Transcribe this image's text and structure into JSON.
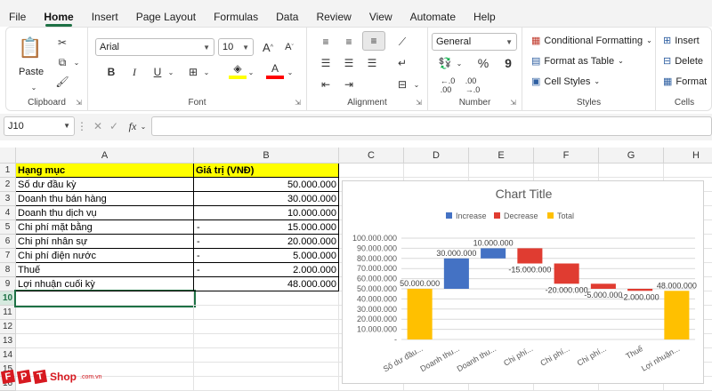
{
  "menu": {
    "tabs": [
      "File",
      "Home",
      "Insert",
      "Page Layout",
      "Formulas",
      "Data",
      "Review",
      "View",
      "Automate",
      "Help"
    ],
    "active": "Home"
  },
  "ribbon": {
    "clipboard": {
      "label": "Clipboard",
      "paste": "Paste"
    },
    "font": {
      "label": "Font",
      "name": "Arial",
      "size": "10",
      "bold": "B",
      "italic": "I",
      "underline": "U"
    },
    "alignment": {
      "label": "Alignment"
    },
    "number": {
      "label": "Number",
      "format": "General",
      "percent": "%",
      "comma": "9"
    },
    "styles": {
      "label": "Styles",
      "conditional": "Conditional Formatting",
      "format_table": "Format as Table",
      "cell_styles": "Cell Styles"
    },
    "cells": {
      "label": "Cells",
      "insert": "Insert",
      "delete": "Delete",
      "format": "Format"
    },
    "colors": {
      "accent": "#1e7145",
      "highlight": "#ffff00",
      "font_color": "#ff0000"
    }
  },
  "formula_bar": {
    "name_box": "J10",
    "fx": "fx",
    "value": ""
  },
  "sheet": {
    "columns": [
      "A",
      "B",
      "C",
      "D",
      "E",
      "F",
      "G",
      "H"
    ],
    "rows": [
      "1",
      "2",
      "3",
      "4",
      "5",
      "6",
      "7",
      "8",
      "9",
      "10",
      "11",
      "12",
      "13",
      "14",
      "15",
      "16"
    ],
    "selected_row": "10",
    "header": {
      "a": "Hạng mục",
      "b": "Giá trị (VNĐ)"
    },
    "data": [
      {
        "a": "Số dư đầu kỳ",
        "sign": "",
        "b": "50.000.000"
      },
      {
        "a": "Doanh thu bán hàng",
        "sign": "",
        "b": "30.000.000"
      },
      {
        "a": "Doanh thu dịch vụ",
        "sign": "",
        "b": "10.000.000"
      },
      {
        "a": "Chi phí mặt bằng",
        "sign": "-",
        "b": "15.000.000"
      },
      {
        "a": "Chi phí nhân sự",
        "sign": "-",
        "b": "20.000.000"
      },
      {
        "a": "Chi phí điện nước",
        "sign": "-",
        "b": "5.000.000"
      },
      {
        "a": "Thuế",
        "sign": "-",
        "b": "2.000.000"
      },
      {
        "a": "Lợi nhuận cuối kỳ",
        "sign": "",
        "b": "48.000.000"
      }
    ]
  },
  "chart_data": {
    "type": "bar",
    "title": "Chart Title",
    "legend": [
      {
        "name": "Increase",
        "color": "#4472c4"
      },
      {
        "name": "Decrease",
        "color": "#e03c31"
      },
      {
        "name": "Total",
        "color": "#ffc000"
      }
    ],
    "legend_position": "top",
    "categories": [
      "Số dư đầu...",
      "Doanh thu...",
      "Doanh thu...",
      "Chi phí...",
      "Chi phí...",
      "Chi phí...",
      "Thuế",
      "Lợi nhuận..."
    ],
    "values": [
      50000000,
      30000000,
      10000000,
      -15000000,
      -20000000,
      -5000000,
      -2000000,
      48000000
    ],
    "kinds": [
      "total",
      "increase",
      "increase",
      "decrease",
      "decrease",
      "decrease",
      "decrease",
      "total"
    ],
    "data_labels": [
      "50.000.000",
      "30.000.000",
      "10.000.000",
      "-15.000.000",
      "-20.000.000",
      "-5.000.000",
      "-2.000.000",
      "48.000.000"
    ],
    "ylim": [
      0,
      100000000
    ],
    "yticks": [
      0,
      10000000,
      20000000,
      30000000,
      40000000,
      50000000,
      60000000,
      70000000,
      80000000,
      90000000,
      100000000
    ],
    "ytick_labels": [
      "-",
      "10.000.000",
      "20.000.000",
      "30.000.000",
      "40.000.000",
      "50.000.000",
      "60.000.000",
      "70.000.000",
      "80.000.000",
      "90.000.000",
      "100.000.000"
    ],
    "grid": true
  },
  "watermark": {
    "letters": [
      "F",
      "P",
      "T"
    ],
    "shop": "Shop",
    "domain": ".com.vn"
  }
}
